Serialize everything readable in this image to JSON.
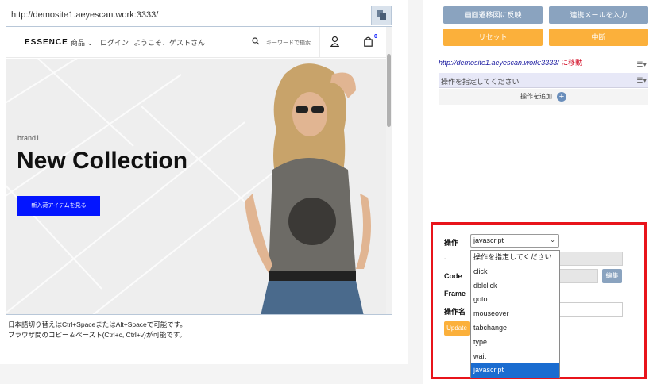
{
  "left": {
    "url": "http://demosite1.aeyescan.work:3333/",
    "site": {
      "logo": "ESSENCE",
      "nav_products": "商品",
      "nav_login": "ログイン",
      "nav_welcome": "ようこそ、ゲストさん",
      "search_placeholder": "キーワードで検索",
      "cart_count": "0",
      "brand": "brand1",
      "hero_title": "New Collection",
      "hero_button": "新入荷アイテムを見る"
    },
    "hint_line1": "日本語切り替えはCtrl+SpaceまたはAlt+Spaceで可能です。",
    "hint_line2": "ブラウザ間のコピー＆ペースト(Ctrl+c, Ctrl+v)が可能です。"
  },
  "right": {
    "btn_reflect": "画面遷移図に反映",
    "btn_email": "連携メールを入力",
    "btn_reset": "リセット",
    "btn_abort": "中断",
    "steps": [
      {
        "url": "http://demosite1.aeyescan.work:3333/",
        "suffix": " に移動"
      },
      {
        "label": "操作を指定してください"
      }
    ],
    "add_step": "操作を追加",
    "edit": {
      "op_label": "操作",
      "dash_label": "-",
      "code_label": "Code",
      "frame_label": "Frame",
      "name_label": "操作名",
      "selected_op": "javascript",
      "edit_button": "編集",
      "update_button": "Update",
      "options": [
        "操作を指定してください",
        "click",
        "dblclick",
        "goto",
        "mouseover",
        "tabchange",
        "type",
        "wait",
        "javascript"
      ]
    }
  },
  "colors": {
    "accent_blue": "#0315ff",
    "highlight_red": "#e8141b",
    "orange": "#fbb03b",
    "steel_blue": "#8aa3bf",
    "selected_option": "#1a6cd0"
  }
}
